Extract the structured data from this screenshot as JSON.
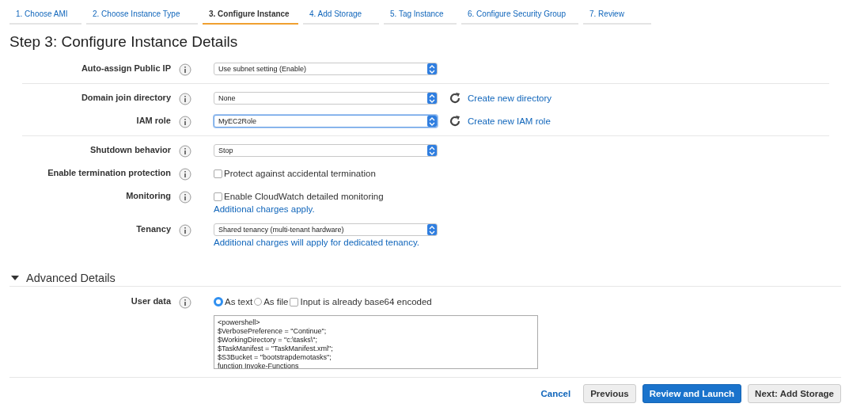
{
  "tabs": [
    {
      "label": "1. Choose AMI",
      "selected": false
    },
    {
      "label": "2. Choose Instance Type",
      "selected": false
    },
    {
      "label": "3. Configure Instance",
      "selected": true
    },
    {
      "label": "4. Add Storage",
      "selected": false
    },
    {
      "label": "5. Tag Instance",
      "selected": false
    },
    {
      "label": "6. Configure Security Group",
      "selected": false
    },
    {
      "label": "7. Review",
      "selected": false
    }
  ],
  "title": "Step 3: Configure Instance Details",
  "groups": [
    [
      {
        "label": "Auto-assign Public IP",
        "kind": "select",
        "value": "Use subnet setting (Enable)",
        "focused": false
      }
    ],
    [
      {
        "label": "Domain join directory",
        "kind": "select",
        "value": "None",
        "focused": false,
        "link": "Create new directory"
      },
      {
        "label": "IAM role",
        "kind": "select",
        "value": "MyEC2Role",
        "focused": true,
        "link": "Create new IAM role"
      }
    ],
    [
      {
        "label": "Shutdown behavior",
        "kind": "select",
        "value": "Stop",
        "focused": false
      },
      {
        "label": "Enable termination protection",
        "kind": "checkbox",
        "text": "Protect against accidental termination",
        "checked": false
      },
      {
        "label": "Monitoring",
        "kind": "checkbox",
        "text": "Enable CloudWatch detailed monitoring",
        "checked": false,
        "note": "Additional charges apply."
      },
      {
        "label": "Tenancy",
        "kind": "select",
        "value": "Shared tenancy (multi-tenant hardware)",
        "focused": false,
        "note": "Additional charges will apply for dedicated tenancy."
      }
    ]
  ],
  "advanced": {
    "title": "Advanced Details",
    "expanded": true,
    "user_data": {
      "label": "User data",
      "options": [
        {
          "label": "As text",
          "selected": true
        },
        {
          "label": "As file",
          "selected": false
        }
      ],
      "base64": {
        "label": "Input is already base64 encoded",
        "checked": false
      },
      "value": "<powershell>\n$VerbosePreference = \"Continue\";\n$WorkingDirectory = \"c:\\tasks\\\";\n$TaskManifest = \"TaskManifest.xml\";\n$S3Bucket = \"bootstrapdemotasks\";\nfunction Invoke-Functions"
    }
  },
  "footer": {
    "cancel": "Cancel",
    "buttons": [
      {
        "label": "Previous",
        "kind": "secondary"
      },
      {
        "label": "Review and Launch",
        "kind": "primary"
      },
      {
        "label": "Next: Add Storage",
        "kind": "secondary"
      }
    ]
  }
}
